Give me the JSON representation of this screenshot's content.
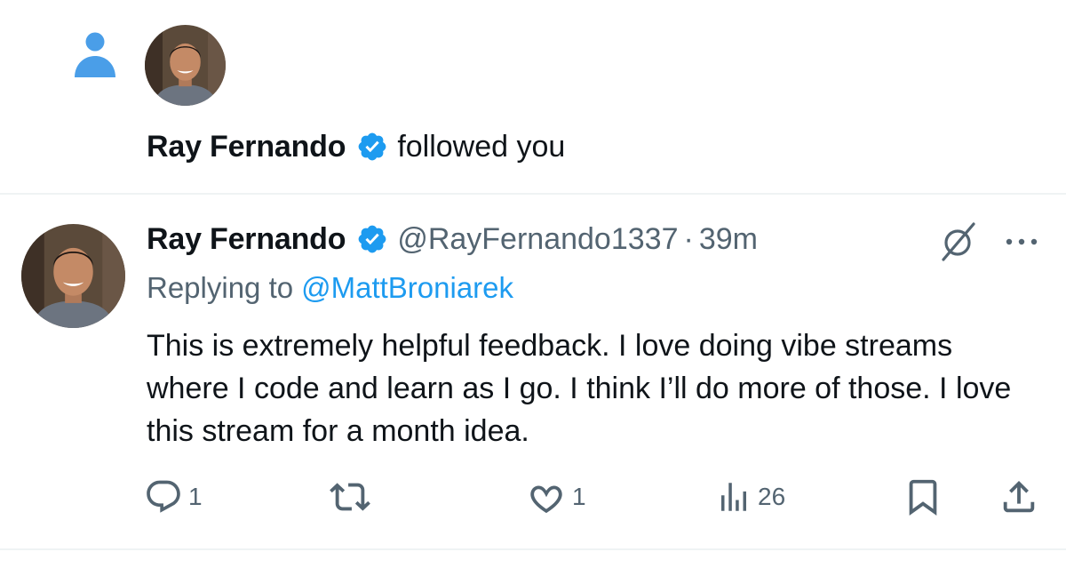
{
  "follow_notification": {
    "user_name": "Ray Fernando",
    "action_text": "followed you",
    "icons": [
      "person-icon",
      "verified-badge-icon"
    ]
  },
  "tweet": {
    "author_name": "Ray Fernando",
    "handle": "@RayFernando1337",
    "separator": "·",
    "time": "39m",
    "replying_prefix": "Replying to",
    "replying_to": "@MattBroniarek",
    "text": "This is extremely helpful feedback. I love doing vibe streams where I code and learn as I go. I think I’ll do more of those. I love this stream for a month idea.",
    "actions": {
      "reply_count": "1",
      "retweet_count": "",
      "like_count": "1",
      "view_count": "26"
    }
  },
  "colors": {
    "accent_blue": "#1d9bf0",
    "secondary_text": "#536471",
    "primary_text": "#0f1419",
    "divider": "#eff3f4",
    "verified_blue": "#1d9bf0",
    "follow_icon_blue": "#4a9ee8"
  }
}
